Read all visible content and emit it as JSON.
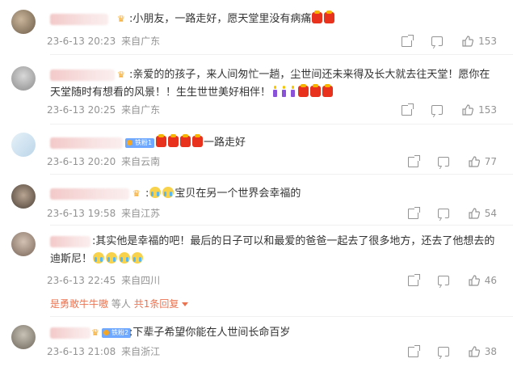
{
  "comments": [
    {
      "text": ":小朋友，一路走好，愿天堂里没有病痛",
      "emojis": [
        "hongbao",
        "hongbao"
      ],
      "date": "23-6-13 20:23",
      "location": "来自广东",
      "likes": "153"
    },
    {
      "text": ":亲爱的的孩子，来人间匆忙一趟，尘世间还未来得及长大就去往天堂！愿你在天堂随时有想看的风景！！生生世世美好相伴！",
      "emojis": [
        "candle",
        "candle",
        "candle",
        "hongbao",
        "hongbao",
        "hongbao"
      ],
      "date": "23-6-13 20:25",
      "location": "来自广东",
      "likes": "153"
    },
    {
      "badge": "铁粉1",
      "text": "一路走好",
      "date": "23-6-13 20:20",
      "location": "来自云南",
      "likes": "77"
    },
    {
      "text": "宝贝在另一个世界会幸福的",
      "date": "23-6-13 19:58",
      "location": "来自江苏",
      "likes": "54"
    },
    {
      "text": ":其实他是幸福的吧！最后的日子可以和最爱的爸爸一起去了很多地方，还去了他想去的迪斯尼！",
      "date": "23-6-13 22:45",
      "location": "来自四川",
      "likes": "46",
      "reply_user": "是勇敢牛牛嗷",
      "reply_mid": "等人",
      "reply_count": "共1条回复"
    },
    {
      "badge": "铁粉2",
      "text": ":下辈子希望你能在人世间长命百岁",
      "date": "23-6-13 21:08",
      "location": "来自浙江",
      "likes": "38"
    }
  ],
  "icons": {
    "share": "share-icon",
    "comment": "comment-icon",
    "like": "like-icon"
  },
  "colors": {
    "meta": "#939393",
    "reply_link": "#eb7350",
    "text": "#333333"
  }
}
